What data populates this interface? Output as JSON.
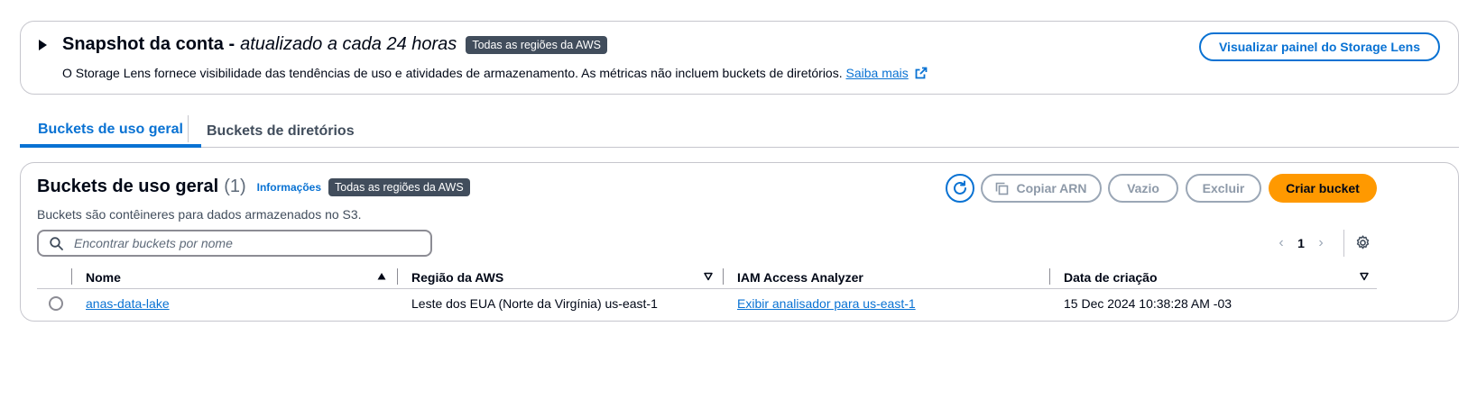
{
  "snapshot": {
    "title": "Snapshot da conta -",
    "subtitle": "atualizado a cada 24 horas",
    "badge": "Todas as regiões da AWS",
    "description": "O Storage Lens fornece visibilidade das tendências de uso e atividades de armazenamento. As métricas não incluem buckets de diretórios.",
    "learn_more": "Saiba mais",
    "view_dashboard_button": "Visualizar painel do Storage Lens"
  },
  "tabs": [
    {
      "label": "Buckets de uso geral",
      "active": true
    },
    {
      "label": "Buckets de diretórios",
      "active": false
    }
  ],
  "buckets_panel": {
    "title": "Buckets de uso geral",
    "count": "(1)",
    "info_link": "Informações",
    "badge": "Todas as regiões da AWS",
    "description": "Buckets são contêineres para dados armazenados no S3.",
    "actions": {
      "copy_arn": "Copiar ARN",
      "empty": "Vazio",
      "delete": "Excluir",
      "create": "Criar bucket"
    },
    "search": {
      "placeholder": "Encontrar buckets por nome",
      "value": ""
    },
    "pagination": {
      "current_page": "1"
    },
    "table": {
      "columns": [
        "Nome",
        "Região da AWS",
        "IAM Access Analyzer",
        "Data de criação"
      ],
      "rows": [
        {
          "name": "anas-data-lake",
          "region": "Leste dos EUA (Norte da Virgínia) us-east-1",
          "analyzer": "Exibir analisador para us-east-1",
          "created": "15 Dec 2024 10:38:28 AM -03"
        }
      ]
    }
  },
  "colors": {
    "link_blue": "#0972d3",
    "primary_orange": "#ff9900",
    "badge_gray": "#414d5c",
    "border": "#c6c6cd"
  }
}
